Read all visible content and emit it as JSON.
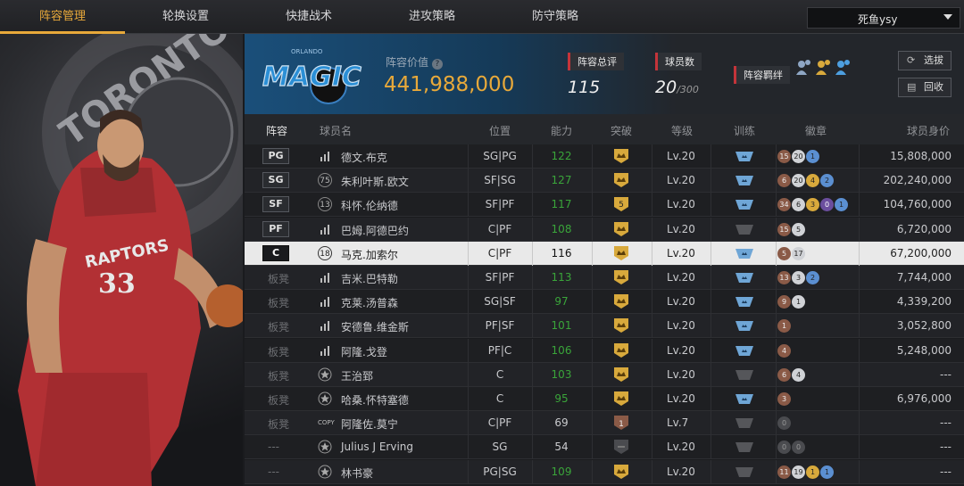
{
  "tabs": [
    "阵容管理",
    "轮换设置",
    "快捷战术",
    "进攻策略",
    "防守策略"
  ],
  "account": {
    "name": "死鱼ysy"
  },
  "colors": {
    "accent": "#e8a93a",
    "team_blue": "#1a4f7a",
    "raptors_red": "#c4343a"
  },
  "player_panel": {
    "team_text": "TORONTO",
    "jersey_team": "RAPTORS",
    "jersey_number": "33"
  },
  "team": {
    "logo_text": "MAGIC",
    "logo_subtext": "ORLANDO"
  },
  "lineup_value": {
    "label": "阵容价值",
    "value": "441,988,000"
  },
  "stats": {
    "rating": {
      "label": "阵容总评",
      "value": "115"
    },
    "count": {
      "label": "球员数",
      "value": "20",
      "max": "/300"
    },
    "bond": {
      "label": "阵容羁绊",
      "icons": [
        "team-bond-icon",
        "team-bond-icon-gold",
        "team-bond-icon-blue"
      ]
    }
  },
  "buttons": {
    "scout": "选拔",
    "recycle": "回收"
  },
  "columns": {
    "lineup": "阵容",
    "name": "球员名",
    "position": "位置",
    "ability": "能力",
    "breakthrough": "突破",
    "level": "等级",
    "training": "训练",
    "badge": "徽章",
    "salary": "球员身价"
  },
  "rows": [
    {
      "slot": "PG",
      "icon": "bars",
      "name": "德文.布克",
      "position": "SG|PG",
      "ability": "122",
      "level": "Lv.20",
      "salary": "15,808,000",
      "shield": "gold",
      "train": "blue",
      "badges": [
        [
          "br",
          "15"
        ],
        [
          "si",
          "20"
        ],
        [
          "bl",
          "1"
        ]
      ]
    },
    {
      "slot": "SG",
      "icon": "75",
      "name": "朱利叶斯.欧文",
      "position": "SF|SG",
      "ability": "127",
      "level": "Lv.20",
      "salary": "202,240,000",
      "shield": "gold",
      "train": "blue",
      "badges": [
        [
          "br",
          "6"
        ],
        [
          "si",
          "20"
        ],
        [
          "go",
          "4"
        ],
        [
          "bl",
          "2"
        ]
      ]
    },
    {
      "slot": "SF",
      "icon": "13",
      "name": "科怀.伦纳德",
      "position": "SF|PF",
      "ability": "117",
      "level": "Lv.20",
      "salary": "104,760,000",
      "shield": "gold5",
      "train": "blue",
      "badges": [
        [
          "br",
          "34"
        ],
        [
          "si",
          "6"
        ],
        [
          "go",
          "3"
        ],
        [
          "pu",
          "0"
        ],
        [
          "bl",
          "1"
        ]
      ]
    },
    {
      "slot": "PF",
      "icon": "bars",
      "name": "巴姆.阿德巴约",
      "position": "C|PF",
      "ability": "108",
      "level": "Lv.20",
      "salary": "6,720,000",
      "shield": "gold",
      "train": "grey",
      "badges": [
        [
          "br",
          "15"
        ],
        [
          "si",
          "5"
        ]
      ]
    },
    {
      "slot": "C",
      "icon": "18",
      "name": "马克.加索尔",
      "position": "C|PF",
      "ability": "116",
      "level": "Lv.20",
      "salary": "67,200,000",
      "shield": "gold",
      "train": "blue",
      "badges": [
        [
          "br",
          "5"
        ],
        [
          "si",
          "17"
        ]
      ]
    },
    {
      "slot": "板凳",
      "icon": "bars",
      "name": "吉米.巴特勒",
      "position": "SF|PF",
      "ability": "113",
      "level": "Lv.20",
      "salary": "7,744,000",
      "shield": "gold",
      "train": "blue",
      "badges": [
        [
          "br",
          "13"
        ],
        [
          "si",
          "3"
        ],
        [
          "bl",
          "2"
        ]
      ]
    },
    {
      "slot": "板凳",
      "icon": "bars",
      "name": "克莱.汤普森",
      "position": "SG|SF",
      "ability": "97",
      "level": "Lv.20",
      "salary": "4,339,200",
      "shield": "gold",
      "train": "blue",
      "badges": [
        [
          "br",
          "9"
        ],
        [
          "si",
          "1"
        ]
      ]
    },
    {
      "slot": "板凳",
      "icon": "bars",
      "name": "安德鲁.维金斯",
      "position": "PF|SF",
      "ability": "101",
      "level": "Lv.20",
      "salary": "3,052,800",
      "shield": "gold",
      "train": "blue",
      "badges": [
        [
          "br",
          "1"
        ]
      ]
    },
    {
      "slot": "板凳",
      "icon": "bars",
      "name": "阿隆.戈登",
      "position": "PF|C",
      "ability": "106",
      "level": "Lv.20",
      "salary": "5,248,000",
      "shield": "gold",
      "train": "blue",
      "badges": [
        [
          "br",
          "4"
        ]
      ]
    },
    {
      "slot": "板凳",
      "icon": "star",
      "name": "王治郅",
      "position": "C",
      "ability": "103",
      "level": "Lv.20",
      "salary": "---",
      "shield": "gold",
      "train": "grey",
      "badges": [
        [
          "br",
          "6"
        ],
        [
          "si",
          "4"
        ]
      ]
    },
    {
      "slot": "板凳",
      "icon": "star",
      "name": "哈桑.怀特塞德",
      "position": "C",
      "ability": "95",
      "level": "Lv.20",
      "salary": "6,976,000",
      "shield": "gold",
      "train": "blue",
      "badges": [
        [
          "br",
          "3"
        ]
      ]
    },
    {
      "slot": "板凳",
      "icon": "COPY",
      "name": "阿隆佐.莫宁",
      "position": "C|PF",
      "ability": "69",
      "level": "Lv.7",
      "salary": "---",
      "shield": "brown1",
      "train": "grey",
      "badges": [
        [
          "gr",
          "0"
        ]
      ]
    },
    {
      "slot": "---",
      "icon": "star",
      "name": "Julius J Erving",
      "position": "SG",
      "ability": "54",
      "level": "Lv.20",
      "salary": "---",
      "shield": "grey",
      "train": "grey",
      "badges": [
        [
          "gr",
          "0"
        ],
        [
          "gr",
          "0"
        ]
      ]
    },
    {
      "slot": "---",
      "icon": "star",
      "name": "林书豪",
      "position": "PG|SG",
      "ability": "109",
      "level": "Lv.20",
      "salary": "---",
      "shield": "gold",
      "train": "grey",
      "badges": [
        [
          "br",
          "11"
        ],
        [
          "si",
          "19"
        ],
        [
          "go",
          "1"
        ],
        [
          "bl",
          "1"
        ]
      ]
    }
  ]
}
